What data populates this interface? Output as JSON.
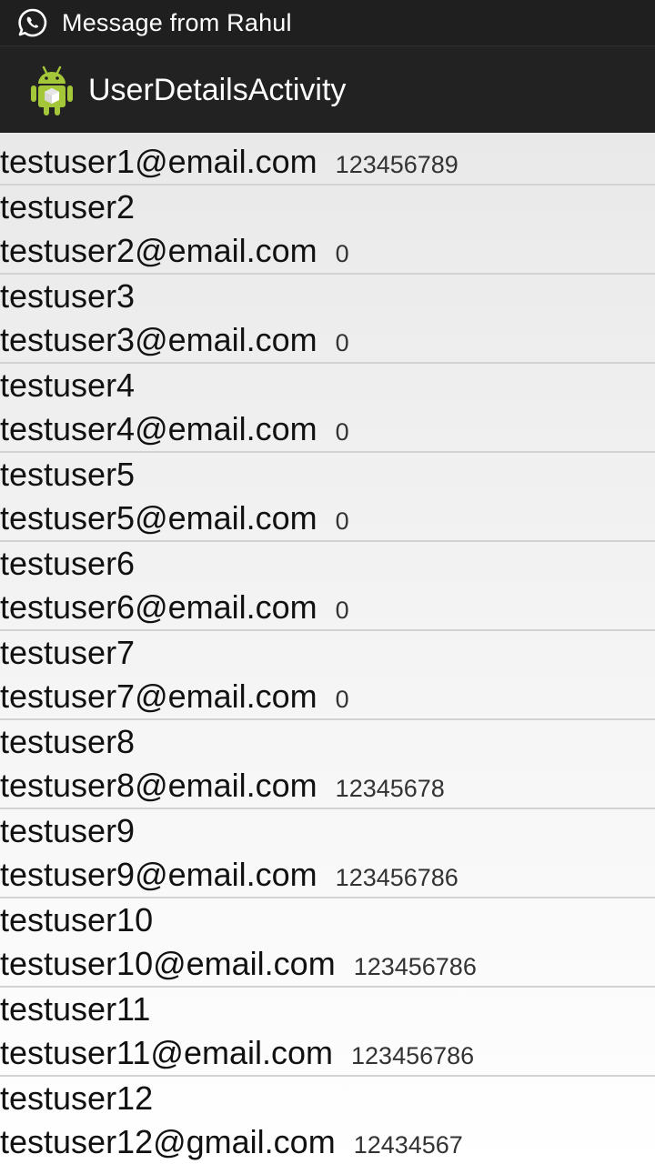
{
  "status_bar": {
    "notification_icon": "whatsapp-icon",
    "notification_text": "Message from Rahul"
  },
  "action_bar": {
    "app_icon": "android-app-icon",
    "title": "UserDetailsActivity"
  },
  "users": [
    {
      "name": "",
      "email": "testuser1@email.com",
      "phone": "123456789"
    },
    {
      "name": "testuser2",
      "email": "testuser2@email.com",
      "phone": "0"
    },
    {
      "name": "testuser3",
      "email": "testuser3@email.com",
      "phone": "0"
    },
    {
      "name": "testuser4",
      "email": "testuser4@email.com",
      "phone": "0"
    },
    {
      "name": "testuser5",
      "email": "testuser5@email.com",
      "phone": "0"
    },
    {
      "name": "testuser6",
      "email": "testuser6@email.com",
      "phone": "0"
    },
    {
      "name": "testuser7",
      "email": "testuser7@email.com",
      "phone": "0"
    },
    {
      "name": "testuser8",
      "email": "testuser8@email.com",
      "phone": "12345678"
    },
    {
      "name": "testuser9",
      "email": "testuser9@email.com",
      "phone": "123456786"
    },
    {
      "name": "testuser10",
      "email": "testuser10@email.com",
      "phone": "123456786"
    },
    {
      "name": "testuser11",
      "email": "testuser11@email.com",
      "phone": "123456786"
    },
    {
      "name": "testuser12",
      "email": "testuser12@gmail.com",
      "phone": "12434567"
    }
  ]
}
